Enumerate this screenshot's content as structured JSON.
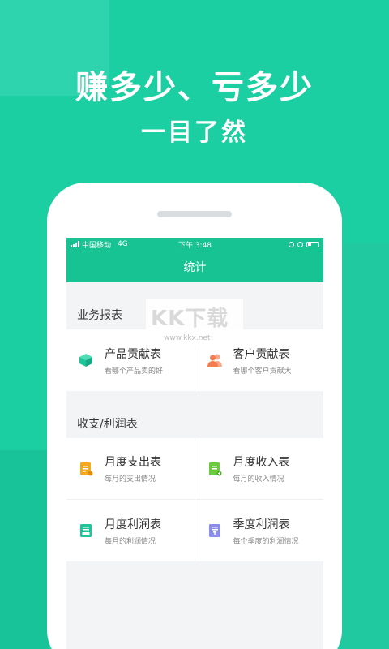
{
  "promo": {
    "headline": "赚多少、亏多少",
    "subline": "一目了然"
  },
  "status": {
    "carrier": "中国移动",
    "network": "4G",
    "time": "下午 3:48"
  },
  "nav": {
    "title": "统计"
  },
  "sections": [
    {
      "title": "业务报表",
      "items": [
        {
          "icon": "cube-icon",
          "color": "#1fc59a",
          "label": "产品贡献表",
          "desc": "看哪个产品卖的好"
        },
        {
          "icon": "customers-icon",
          "color": "#f47c4f",
          "label": "客户贡献表",
          "desc": "看哪个客户贡献大"
        }
      ]
    },
    {
      "title": "收支/利润表",
      "items": [
        {
          "icon": "expense-doc-icon",
          "color": "#f7a821",
          "label": "月度支出表",
          "desc": "每月的支出情况"
        },
        {
          "icon": "income-doc-icon",
          "color": "#6acb3c",
          "label": "月度收入表",
          "desc": "每月的收入情况"
        },
        {
          "icon": "monthly-profit-icon",
          "color": "#1fc59a",
          "label": "月度利润表",
          "desc": "每月的利润情况"
        },
        {
          "icon": "quarterly-profit-icon",
          "color": "#8b8ee8",
          "label": "季度利润表",
          "desc": "每个季度的利润情况"
        }
      ]
    }
  ],
  "watermark": {
    "text": "KK下载",
    "url": "www.kkx.net"
  }
}
